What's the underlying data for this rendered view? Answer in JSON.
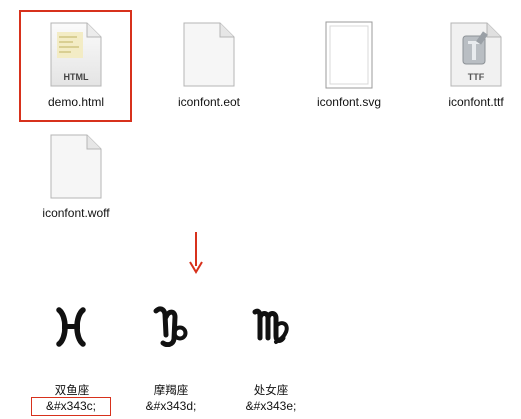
{
  "files": [
    {
      "name": "demo.html",
      "badge": "HTML",
      "icon": "html-file-icon",
      "selected": true
    },
    {
      "name": "iconfont.eot",
      "icon": "generic-file-icon"
    },
    {
      "name": "iconfont.svg",
      "icon": "svg-file-icon"
    },
    {
      "name": "iconfont.ttf",
      "badge": "TTF",
      "icon": "ttf-font-file-icon"
    },
    {
      "name": "iconfont.woff",
      "icon": "generic-file-icon"
    }
  ],
  "colors": {
    "highlight": "#d7311c"
  },
  "glyphs": [
    {
      "icon": "pisces-icon",
      "name": "双鱼座",
      "code": "&#x343c;",
      "boxed": true
    },
    {
      "icon": "capricorn-icon",
      "name": "摩羯座",
      "code": "&#x343d;"
    },
    {
      "icon": "virgo-icon",
      "name": "处女座",
      "code": "&#x343e;"
    }
  ]
}
